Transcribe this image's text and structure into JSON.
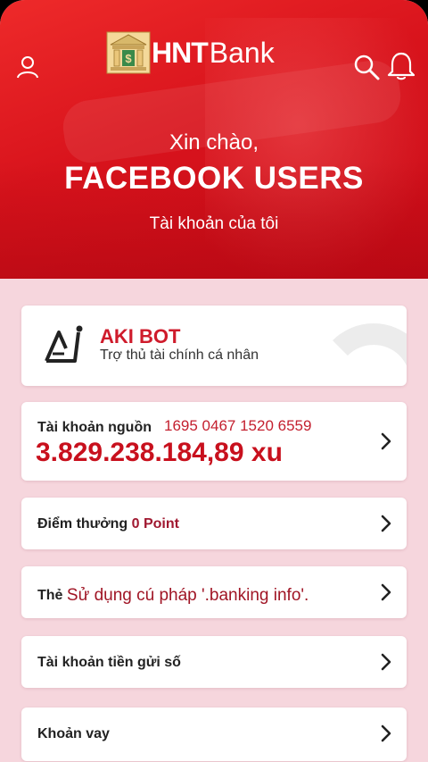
{
  "header": {
    "logo_bold": "HNT",
    "logo_light": "Bank",
    "icons": [
      "user-icon",
      "search-icon",
      "bell-icon"
    ]
  },
  "greeting": {
    "hello": "Xin chào,",
    "name": "FACEBOOK USERS",
    "account_label": "Tài khoản của tôi"
  },
  "bot": {
    "title": "AKI BOT",
    "subtitle": "Trợ thủ tài chính cá nhân"
  },
  "source_account": {
    "label": "Tài khoản nguồn",
    "number": "1695 0467 1520 6559",
    "balance": "3.829.238.184,89 xu"
  },
  "points": {
    "label": "Điểm thưởng",
    "value": "0 Point"
  },
  "card": {
    "label": "Thẻ",
    "value": "Sử dụng cú pháp '.banking info'."
  },
  "savings": {
    "label": "Tài khoản tiền gửi số"
  },
  "loan": {
    "label": "Khoản vay"
  },
  "colors": {
    "brand_red": "#d8131c",
    "accent_text": "#c8101d",
    "background": "#f6d6dd"
  }
}
